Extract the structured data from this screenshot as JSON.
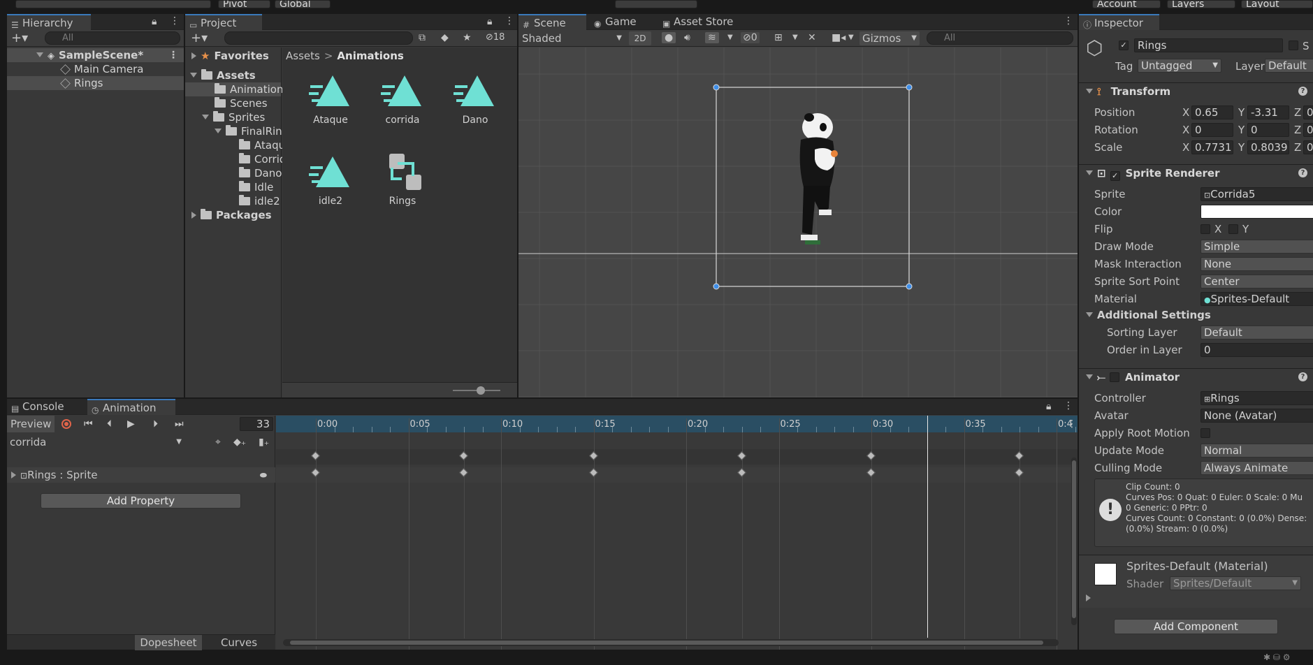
{
  "toolbar": {
    "pivot": "Pivot",
    "global": "Global",
    "account": "Account",
    "layers": "Layers",
    "layout": "Layout"
  },
  "hierarchy": {
    "tab": "Hierarchy",
    "search_placeholder": "All",
    "scene": "SampleScene*",
    "items": [
      "Main Camera",
      "Rings"
    ]
  },
  "project": {
    "tab": "Project",
    "hidden_count": "18",
    "tree": {
      "favorites": "Favorites",
      "assets": "Assets",
      "animations": "Animations",
      "scenes": "Scenes",
      "sprites": "Sprites",
      "finalrings": "FinalRin",
      "ataque": "Ataqu",
      "corrida": "Corrid",
      "dano": "Dano",
      "idle": "Idle",
      "idle2": "idle2",
      "packages": "Packages"
    },
    "breadcrumb": {
      "root": "Assets",
      "sep": ">",
      "current": "Animations"
    },
    "assets": [
      "Ataque",
      "corrida",
      "Dano",
      "idle2",
      "Rings"
    ]
  },
  "scene": {
    "tabs": [
      "Scene",
      "Game",
      "Asset Store"
    ],
    "shading": "Shaded",
    "mode2d": "2D",
    "hidden_objects": "0",
    "gizmos": "Gizmos",
    "search_placeholder": "All"
  },
  "inspector": {
    "tab": "Inspector",
    "object_name": "Rings",
    "static_label": "S",
    "tag_label": "Tag",
    "tag_value": "Untagged",
    "layer_label": "Layer",
    "layer_value": "Default",
    "transform": {
      "title": "Transform",
      "position_label": "Position",
      "pos_x": "0.65",
      "pos_y": "-3.31",
      "pos_z": "0",
      "rotation_label": "Rotation",
      "rot_x": "0",
      "rot_y": "0",
      "rot_z": "0",
      "scale_label": "Scale",
      "scale_x": "0.7731",
      "scale_y": "0.8039",
      "scale_z": "0"
    },
    "sprite_renderer": {
      "title": "Sprite Renderer",
      "sprite_label": "Sprite",
      "sprite_value": "Corrida5",
      "color_label": "Color",
      "flip_label": "Flip",
      "flip_x": "X",
      "flip_y": "Y",
      "draw_mode_label": "Draw Mode",
      "draw_mode_value": "Simple",
      "mask_label": "Mask Interaction",
      "mask_value": "None",
      "sort_point_label": "Sprite Sort Point",
      "sort_point_value": "Center",
      "material_label": "Material",
      "material_value": "Sprites-Default",
      "additional": "Additional Settings",
      "sorting_layer_label": "Sorting Layer",
      "sorting_layer_value": "Default",
      "order_label": "Order in Layer",
      "order_value": "0"
    },
    "animator": {
      "title": "Animator",
      "controller_label": "Controller",
      "controller_value": "Rings",
      "avatar_label": "Avatar",
      "avatar_value": "None (Avatar)",
      "root_motion_label": "Apply Root Motion",
      "update_label": "Update Mode",
      "update_value": "Normal",
      "culling_label": "Culling Mode",
      "culling_value": "Always Animate",
      "info": [
        "Clip Count: 0",
        "Curves Pos: 0 Quat: 0 Euler: 0 Scale: 0 Mu",
        "0 Generic: 0 PPtr: 0",
        "Curves Count: 0 Constant: 0 (0.0%) Dense:",
        "(0.0%) Stream: 0 (0.0%)"
      ]
    },
    "material": {
      "name": "Sprites-Default (Material)",
      "shader_label": "Shader",
      "shader_value": "Sprites/Default"
    },
    "add_component": "Add Component"
  },
  "animation": {
    "tabs": [
      "Console",
      "Animation"
    ],
    "preview": "Preview",
    "frame": "33",
    "clip": "corrida",
    "property": "Rings : Sprite",
    "add_property": "Add Property",
    "dopesheet": "Dopesheet",
    "curves": "Curves",
    "ruler": [
      "0:00",
      "0:05",
      "0:10",
      "0:15",
      "0:20",
      "0:25",
      "0:30",
      "0:35",
      "0:4"
    ],
    "playhead_frame": 33
  },
  "colors": {
    "accent": "#3a79bb",
    "keyframe": "#bcbcbc",
    "asset_icon": "#6fe0d4",
    "record": "#e0644a"
  }
}
